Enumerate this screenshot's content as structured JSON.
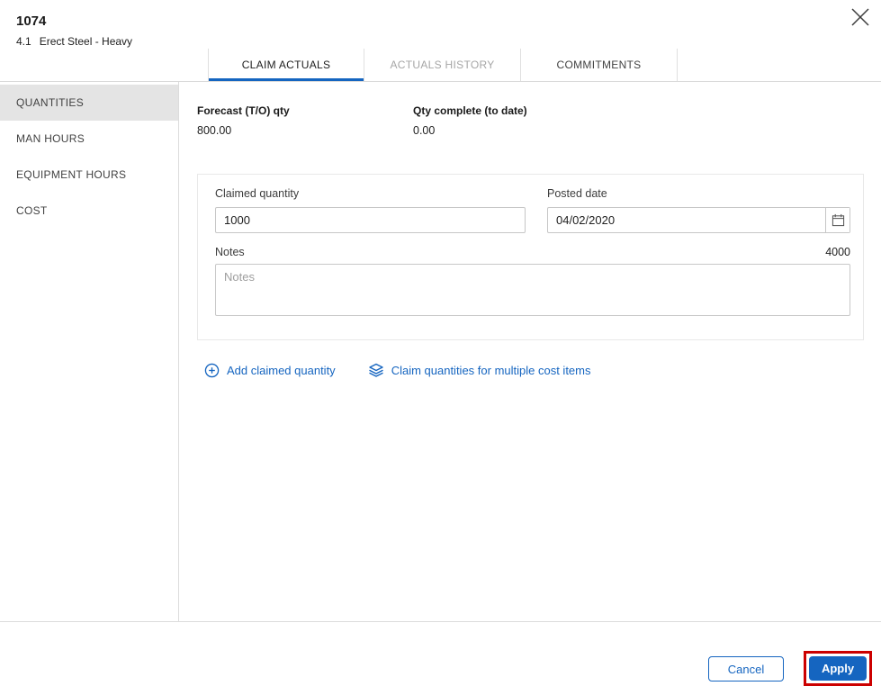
{
  "dialog": {
    "title": "1074",
    "subtitle_code": "4.1",
    "subtitle_name": "Erect Steel - Heavy"
  },
  "tabs": [
    {
      "label": "CLAIM ACTUALS",
      "state": "active"
    },
    {
      "label": "ACTUALS HISTORY",
      "state": "disabled"
    },
    {
      "label": "COMMITMENTS",
      "state": "normal"
    }
  ],
  "sidebar": {
    "items": [
      {
        "label": "QUANTITIES",
        "selected": true
      },
      {
        "label": "MAN HOURS",
        "selected": false
      },
      {
        "label": "EQUIPMENT HOURS",
        "selected": false
      },
      {
        "label": "COST",
        "selected": false
      }
    ]
  },
  "summary": {
    "forecast_label": "Forecast (T/O) qty",
    "forecast_value": "800.00",
    "qty_complete_label": "Qty complete (to date)",
    "qty_complete_value": "0.00"
  },
  "form": {
    "claimed_quantity": {
      "label": "Claimed quantity",
      "value": "1000"
    },
    "posted_date": {
      "label": "Posted date",
      "value": "04/02/2020"
    },
    "notes": {
      "label": "Notes",
      "placeholder": "Notes",
      "value": "",
      "char_count": "4000"
    }
  },
  "links": {
    "add_claimed_quantity": "Add claimed quantity",
    "claim_multiple": "Claim quantities for multiple cost items"
  },
  "footer": {
    "cancel_label": "Cancel",
    "apply_label": "Apply"
  },
  "icons": {
    "close": "close-icon",
    "calendar": "calendar-icon",
    "add": "plus-circle-icon",
    "multiple": "layers-icon"
  },
  "colors": {
    "accent": "#1565c0",
    "highlight_box": "#cc0000",
    "selected_item_bg": "#e4e4e4"
  }
}
